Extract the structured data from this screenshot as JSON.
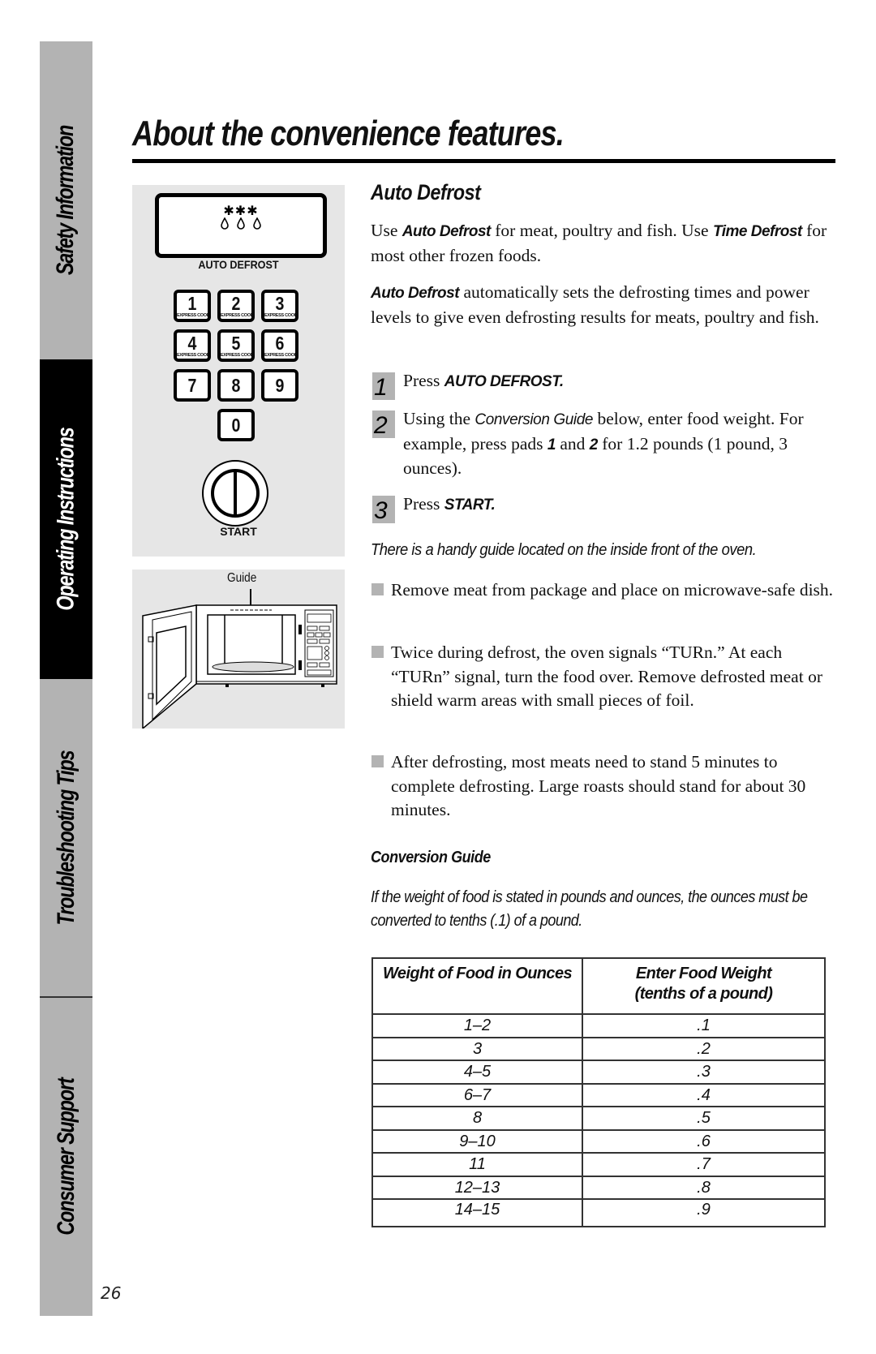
{
  "sidebar": {
    "tabs": [
      {
        "label": "Safety Information",
        "active": false
      },
      {
        "label": "Operating Instructions",
        "active": true
      },
      {
        "label": "Troubleshooting Tips",
        "active": false
      },
      {
        "label": "Consumer Support",
        "active": false
      }
    ]
  },
  "page_number": "26",
  "header": {
    "title": "About the convenience features."
  },
  "control_panel": {
    "display_icons": [
      "✱✱✱",
      "○○○"
    ],
    "auto_defrost_label": "AUTO DEFROST",
    "keys": [
      {
        "num": "1",
        "sub": "EXPRESS COOK"
      },
      {
        "num": "2",
        "sub": "EXPRESS COOK"
      },
      {
        "num": "3",
        "sub": "EXPRESS COOK"
      },
      {
        "num": "4",
        "sub": "EXPRESS COOK"
      },
      {
        "num": "5",
        "sub": "EXPRESS COOK"
      },
      {
        "num": "6",
        "sub": "EXPRESS COOK"
      },
      {
        "num": "7",
        "sub": ""
      },
      {
        "num": "8",
        "sub": ""
      },
      {
        "num": "9",
        "sub": ""
      },
      {
        "num": "0",
        "sub": ""
      }
    ],
    "start_label": "START"
  },
  "oven_illustration": {
    "guide_label": "Guide"
  },
  "section": {
    "heading": "Auto Defrost",
    "intro": {
      "p1": [
        "Use ",
        "Auto Defrost",
        " for meat, poultry and fish. Use ",
        "Time Defrost",
        " for most other frozen foods."
      ],
      "p2": [
        "Auto Defrost",
        " automatically sets the defrosting times and power levels to give even defrosting results for meats, poultry and fish."
      ]
    },
    "steps": [
      {
        "num": "1",
        "parts": [
          "Press ",
          "AUTO DEFROST."
        ]
      },
      {
        "num": "2",
        "parts": [
          "Using the ",
          "Conversion Guide",
          " below, enter food weight. For example, press pads ",
          "1",
          " and ",
          "2",
          " for 1.2 pounds (1 pound, 3 ounces)."
        ]
      },
      {
        "num": "3",
        "parts": [
          "Press ",
          "START."
        ]
      }
    ],
    "tip": "There is a handy guide located on the inside front of the oven.",
    "bullets": [
      "Remove meat from package and place on microwave-safe dish.",
      "Twice during defrost, the oven signals “TURn.” At each “TURn” signal, turn the food over. Remove defrosted meat or shield warm areas with small pieces of foil.",
      "After defrosting, most meats need to stand 5 minutes to complete defrosting. Large roasts should stand for about 30 minutes."
    ]
  },
  "conversion_guide": {
    "heading": "Conversion Guide",
    "note": "If the weight of food is stated in pounds and ounces, the ounces must be converted to tenths (.1) of a pound.",
    "columns": [
      "Weight of Food in Ounces",
      "Enter Food Weight",
      "(tenths of a pound)"
    ],
    "rows": [
      {
        "ounces": "1–2",
        "tenths": ".1"
      },
      {
        "ounces": "3",
        "tenths": ".2"
      },
      {
        "ounces": "4–5",
        "tenths": ".3"
      },
      {
        "ounces": "6–7",
        "tenths": ".4"
      },
      {
        "ounces": "8",
        "tenths": ".5"
      },
      {
        "ounces": "9–10",
        "tenths": ".6"
      },
      {
        "ounces": "11",
        "tenths": ".7"
      },
      {
        "ounces": "12–13",
        "tenths": ".8"
      },
      {
        "ounces": "14–15",
        "tenths": ".9"
      }
    ]
  }
}
